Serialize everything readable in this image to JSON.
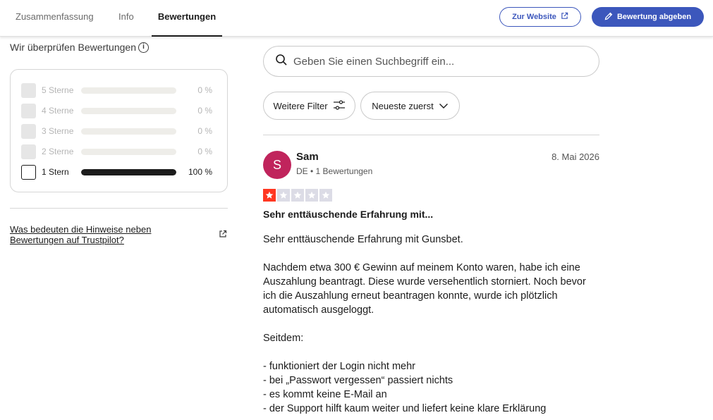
{
  "nav": {
    "tabs": [
      {
        "label": "Zusammenfassung",
        "active": false
      },
      {
        "label": "Info",
        "active": false
      },
      {
        "label": "Bewertungen",
        "active": true
      }
    ],
    "website_button": "Zur Website",
    "review_button": "Bewertung abgeben"
  },
  "sidebar": {
    "verify_text": "Wir überprüfen Bewertungen",
    "distribution": [
      {
        "label": "5 Sterne",
        "percent_text": "0 %",
        "fraction": 0,
        "active": false
      },
      {
        "label": "4 Sterne",
        "percent_text": "0 %",
        "fraction": 0,
        "active": false
      },
      {
        "label": "3 Sterne",
        "percent_text": "0 %",
        "fraction": 0,
        "active": false
      },
      {
        "label": "2 Sterne",
        "percent_text": "0 %",
        "fraction": 0,
        "active": false
      },
      {
        "label": "1 Stern",
        "percent_text": "100 %",
        "fraction": 1,
        "active": true
      }
    ],
    "hint_link_line1": "Was bedeuten die Hinweise neben",
    "hint_link_line2": "Bewertungen auf Trustpilot?"
  },
  "search": {
    "placeholder": "Geben Sie einen Suchbegriff ein..."
  },
  "filters": {
    "more_filters": "Weitere Filter",
    "sort": "Neueste zuerst"
  },
  "review": {
    "avatar_letter": "S",
    "reviewer_name": "Sam",
    "reviewer_meta": "DE • 1 Bewertungen",
    "date": "8. Mai 2026",
    "rating": 1,
    "title": "Sehr enttäuschende Erfahrung mit...",
    "body": [
      "Sehr enttäuschende Erfahrung mit Gunsbet.",
      "",
      "Nachdem etwa 300 € Gewinn auf meinem Konto waren, habe ich eine Auszahlung beantragt. Diese wurde versehentlich storniert. Noch bevor ich die Auszahlung erneut beantragen konnte, wurde ich plötzlich automatisch ausgeloggt.",
      "",
      "Seitdem:",
      "",
      "- funktioniert der Login nicht mehr",
      "- bei „Passwort vergessen“ passiert nichts",
      "- es kommt keine E-Mail an",
      "- der Support hilft kaum weiter und liefert keine klare Erklärung"
    ]
  },
  "colors": {
    "accent": "#3c57bc",
    "star_red": "#ff3722",
    "avatar": "#c0245c"
  },
  "icons": [
    "external-link-icon",
    "pencil-icon",
    "info-icon",
    "search-icon",
    "filter-sliders-icon",
    "chevron-down-icon",
    "star-icon"
  ]
}
